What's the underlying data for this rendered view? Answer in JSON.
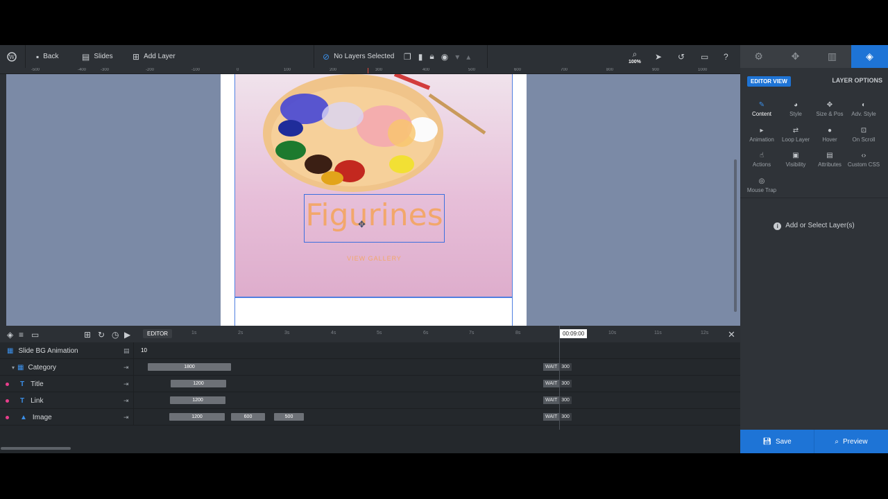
{
  "toolbar": {
    "back": "Back",
    "slides": "Slides",
    "add_layer": "Add Layer",
    "no_layers": "No Layers Selected",
    "zoom": "100%"
  },
  "ruler_labels": [
    "-500",
    "-400",
    "-300",
    "-200",
    "-100",
    "0",
    "100",
    "200",
    "300",
    "400",
    "500",
    "600",
    "700",
    "800",
    "900",
    "1000"
  ],
  "canvas": {
    "title": "Figurines",
    "link": "VIEW GALLERY"
  },
  "right_panel": {
    "editor_view": "EDITOR VIEW",
    "layer_options": "LAYER OPTIONS",
    "options": [
      {
        "label": "Content",
        "icon": "pencil-icon"
      },
      {
        "label": "Style",
        "icon": "palette-icon"
      },
      {
        "label": "Size & Pos",
        "icon": "move-icon"
      },
      {
        "label": "Adv. Style",
        "icon": "drop-icon"
      },
      {
        "label": "Animation",
        "icon": "play-icon"
      },
      {
        "label": "Loop Layer",
        "icon": "loop-icon"
      },
      {
        "label": "Hover",
        "icon": "mouse-icon"
      },
      {
        "label": "On Scroll",
        "icon": "scroll-icon"
      },
      {
        "label": "Actions",
        "icon": "pointer-icon"
      },
      {
        "label": "Visibility",
        "icon": "visibility-icon"
      },
      {
        "label": "Attributes",
        "icon": "file-icon"
      },
      {
        "label": "Custom CSS",
        "icon": "code-icon"
      },
      {
        "label": "Mouse Trap",
        "icon": "target-icon"
      }
    ],
    "select_msg": "Add or Select Layer(s)",
    "save": "Save",
    "preview": "Preview"
  },
  "timeline": {
    "editor": "EDITOR",
    "current_time": "00:09:00",
    "seconds": [
      "1s",
      "2s",
      "3s",
      "4s",
      "5s",
      "6s",
      "7s",
      "8s",
      "10s",
      "11s",
      "12s"
    ],
    "bg_row": {
      "name": "Slide BG Animation",
      "value": "10"
    },
    "rows": [
      {
        "name": "Category",
        "bars": [
          "1800"
        ],
        "wait": "WAIT",
        "wait_val": "300"
      },
      {
        "name": "Title",
        "bars": [
          "1200"
        ],
        "wait": "WAIT",
        "wait_val": "300"
      },
      {
        "name": "Link",
        "bars": [
          "1200"
        ],
        "wait": "WAIT",
        "wait_val": "300"
      },
      {
        "name": "Image",
        "bars": [
          "1200",
          "600",
          "500"
        ],
        "wait": "WAIT",
        "wait_val": "300"
      }
    ]
  }
}
